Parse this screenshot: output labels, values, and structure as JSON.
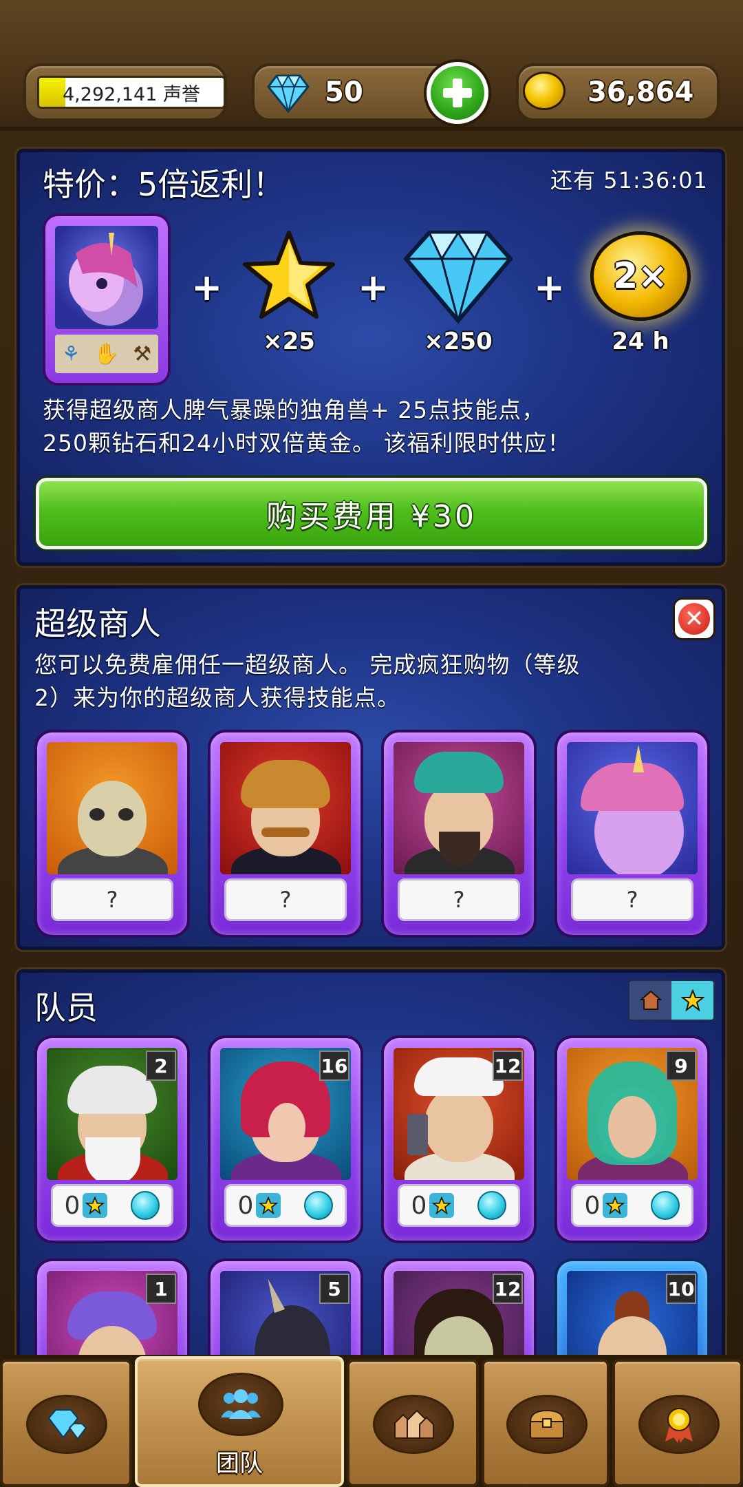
{
  "resources": {
    "reputation_label": "4,292,141 声誉",
    "reputation_progress": 0.14,
    "gems": "50",
    "gold": "36,864"
  },
  "offer": {
    "title": "特价：5倍返利！",
    "timer": "还有 51:36:01",
    "items": {
      "stars_qty": "×25",
      "gems_qty": "×250",
      "gold_boost_label": "2×",
      "gold_boost_duration": "24 h"
    },
    "description_line1": "获得超级商人脾气暴躁的独角兽+ 25点技能点，",
    "description_line2": "250颗钻石和24小时双倍黄金。 该福利限时供应！",
    "buy_label": "购买费用 ¥30"
  },
  "super_merchants": {
    "title": "超级商人",
    "description_line1": "您可以免费雇佣任一超级商人。 完成疯狂购物（等级",
    "description_line2": "2）来为你的超级商人获得技能点。",
    "cards": [
      {
        "placeholder": "?"
      },
      {
        "placeholder": "?"
      },
      {
        "placeholder": "?"
      },
      {
        "placeholder": "?"
      }
    ]
  },
  "team": {
    "title": "队员",
    "members": [
      {
        "level": "2",
        "stars": "0"
      },
      {
        "level": "16",
        "stars": "0"
      },
      {
        "level": "12",
        "stars": "0"
      },
      {
        "level": "9",
        "stars": "0"
      },
      {
        "level": "1"
      },
      {
        "level": "5"
      },
      {
        "level": "12"
      },
      {
        "level": "10"
      }
    ]
  },
  "bottom_nav": {
    "active_label": "团队"
  },
  "colors": {
    "panel_blue": "#1d3384",
    "card_purple": "#9446ee",
    "buy_green": "#4fbe1c",
    "wood": "#b08040"
  }
}
